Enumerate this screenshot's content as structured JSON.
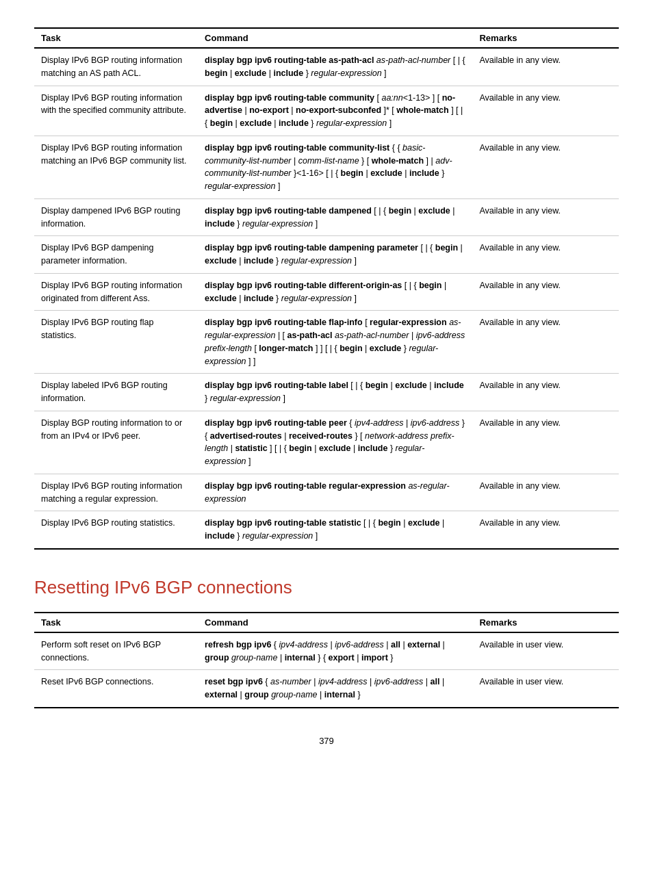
{
  "tables": [
    {
      "headers": [
        "Task",
        "Command",
        "Remarks"
      ],
      "rows": [
        {
          "task": "Display IPv6 BGP routing information matching an AS path ACL.",
          "command_html": "<span class='cmd'>display bgp ipv6 routing-table as-path-acl</span> <span class='italic'>as-path-acl-number</span> [ | { <span class='cmd'>begin</span> | <span class='cmd'>exclude</span> | <span class='cmd'>include</span> } <span class='italic'>regular-expression</span> ]",
          "remarks": "Available in any view."
        },
        {
          "task": "Display IPv6 BGP routing information with the specified community attribute.",
          "command_html": "<span class='cmd'>display bgp ipv6 routing-table community</span> [ <span class='italic'>aa:nn</span>&lt;1-13&gt; ] [ <span class='cmd'>no-advertise</span> | <span class='cmd'>no-export</span> | <span class='cmd'>no-export-subconfed</span> ]* [ <span class='cmd'>whole-match</span> ] [ | { <span class='cmd'>begin</span> | <span class='cmd'>exclude</span> | <span class='cmd'>include</span> } <span class='italic'>regular-expression</span> ]",
          "remarks": "Available in any view."
        },
        {
          "task": "Display IPv6 BGP routing information matching an IPv6 BGP community list.",
          "command_html": "<span class='cmd'>display bgp ipv6 routing-table community-list</span> { { <span class='italic'>basic-community-list-number</span> | <span class='italic'>comm-list-name</span> } [ <span class='cmd'>whole-match</span> ] | <span class='italic'>adv-community-list-number</span> }&lt;1-16&gt; [ | { <span class='cmd'>begin</span> | <span class='cmd'>exclude</span> | <span class='cmd'>include</span> } <span class='italic'>regular-expression</span> ]",
          "remarks": "Available in any view."
        },
        {
          "task": "Display dampened IPv6 BGP routing information.",
          "command_html": "<span class='cmd'>display bgp ipv6 routing-table dampened</span> [ | { <span class='cmd'>begin</span> | <span class='cmd'>exclude</span> | <span class='cmd'>include</span> } <span class='italic'>regular-expression</span> ]",
          "remarks": "Available in any view."
        },
        {
          "task": "Display IPv6 BGP dampening parameter information.",
          "command_html": "<span class='cmd'>display bgp ipv6 routing-table dampening parameter</span> [ | { <span class='cmd'>begin</span> | <span class='cmd'>exclude</span> | <span class='cmd'>include</span> } <span class='italic'>regular-expression</span> ]",
          "remarks": "Available in any view."
        },
        {
          "task": "Display IPv6 BGP routing information originated from different Ass.",
          "command_html": "<span class='cmd'>display bgp ipv6 routing-table different-origin-as</span> [ | { <span class='cmd'>begin</span> | <span class='cmd'>exclude</span> | <span class='cmd'>include</span> } <span class='italic'>regular-expression</span> ]",
          "remarks": "Available in any view."
        },
        {
          "task": "Display IPv6 BGP routing flap statistics.",
          "command_html": "<span class='cmd'>display bgp ipv6 routing-table flap-info</span> [ <span class='cmd'>regular-expression</span> <span class='italic'>as-regular-expression</span> | [ <span class='cmd'>as-path-acl</span> <span class='italic'>as-path-acl-number</span> | <span class='italic'>ipv6-address prefix-length</span> [ <span class='cmd'>longer-match</span> ] ] [ | { <span class='cmd'>begin</span> | <span class='cmd'>exclude</span> } <span class='italic'>regular-expression</span> ] ]",
          "remarks": "Available in any view."
        },
        {
          "task": "Display labeled IPv6 BGP routing information.",
          "command_html": "<span class='cmd'>display bgp ipv6 routing-table label</span> [ | { <span class='cmd'>begin</span> | <span class='cmd'>exclude</span> | <span class='cmd'>include</span> } <span class='italic'>regular-expression</span> ]",
          "remarks": "Available in any view."
        },
        {
          "task": "Display BGP routing information to or from an IPv4 or IPv6 peer.",
          "command_html": "<span class='cmd'>display bgp ipv6 routing-table peer</span> { <span class='italic'>ipv4-address</span> | <span class='italic'>ipv6-address</span> } { <span class='cmd'>advertised-routes</span> | <span class='cmd'>received-routes</span> } [ <span class='italic'>network-address prefix-length</span> | <span class='cmd'>statistic</span> ] [ | { <span class='cmd'>begin</span> | <span class='cmd'>exclude</span> | <span class='cmd'>include</span> } <span class='italic'>regular-expression</span> ]",
          "remarks": "Available in any view."
        },
        {
          "task": "Display IPv6 BGP routing information matching a regular expression.",
          "command_html": "<span class='cmd'>display bgp ipv6 routing-table regular-expression</span> <span class='italic'>as-regular-expression</span>",
          "remarks": "Available in any view."
        },
        {
          "task": "Display IPv6 BGP routing statistics.",
          "command_html": "<span class='cmd'>display bgp ipv6 routing-table statistic</span> [ | { <span class='cmd'>begin</span> | <span class='cmd'>exclude</span> | <span class='cmd'>include</span> } <span class='italic'>regular-expression</span> ]",
          "remarks": "Available in any view."
        }
      ]
    },
    {
      "headers": [
        "Task",
        "Command",
        "Remarks"
      ],
      "rows": [
        {
          "task": "Perform soft reset on IPv6 BGP connections.",
          "command_html": "<span class='cmd'>refresh bgp ipv6</span> { <span class='italic'>ipv4-address</span> | <span class='italic'>ipv6-address</span> | <span class='cmd'>all</span> | <span class='cmd'>external</span> | <span class='cmd'>group</span> <span class='italic'>group-name</span> | <span class='cmd'>internal</span> } { <span class='cmd'>export</span> | <span class='cmd'>import</span> }",
          "remarks": "Available in user view."
        },
        {
          "task": "Reset IPv6 BGP connections.",
          "command_html": "<span class='cmd'>reset bgp ipv6</span> { <span class='italic'>as-number</span> | <span class='italic'>ipv4-address</span> | <span class='italic'>ipv6-address</span> | <span class='cmd'>all</span> | <span class='cmd'>external</span> | <span class='cmd'>group</span> <span class='italic'>group-name</span> | <span class='cmd'>internal</span> }",
          "remarks": "Available in user view."
        }
      ]
    }
  ],
  "section_title": "Resetting IPv6 BGP connections",
  "page_number": "379"
}
